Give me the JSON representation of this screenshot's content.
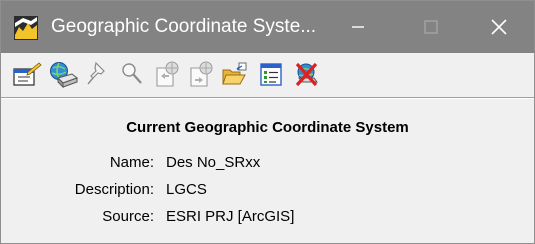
{
  "window": {
    "title": "Geographic Coordinate Syste...",
    "controls": {
      "minimize": "—",
      "maximize": "☐",
      "close": "✕"
    }
  },
  "toolbar": {
    "icons": [
      "edit-properties-icon",
      "select-from-library-icon",
      "pin-icon",
      "search-icon",
      "export-icon",
      "import-icon",
      "open-folder-icon",
      "list-icon",
      "delete-icon"
    ]
  },
  "content": {
    "heading": "Current Geographic Coordinate System",
    "fields": [
      {
        "label": "Name:",
        "value": "Des No_SRxx"
      },
      {
        "label": "Description:",
        "value": "LGCS"
      },
      {
        "label": "Source:",
        "value": "ESRI PRJ [ArcGIS]"
      }
    ]
  },
  "colors": {
    "titlebar_bg": "#838383",
    "window_bg": "#f0f0f0",
    "accent_blue": "#1a5fd0",
    "delete_red": "#e02020"
  }
}
